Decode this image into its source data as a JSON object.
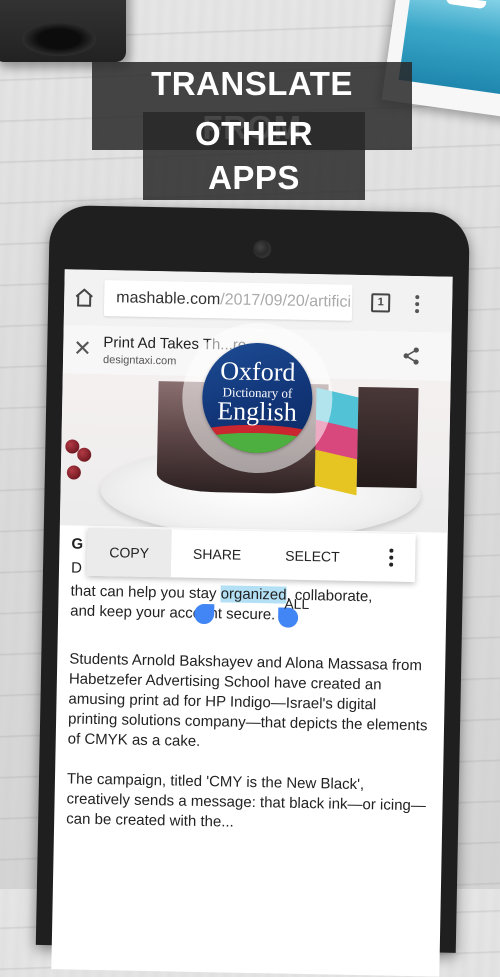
{
  "headline": {
    "line1": "TRANSLATE FROM",
    "line2": "OTHER APPS"
  },
  "browser": {
    "url_domain": "mashable.com",
    "url_path": "/2017/09/20/artifici",
    "tab_count": "1"
  },
  "custom_tab": {
    "title": "Print Ad Takes Th...re...",
    "domain": "designtaxi.com"
  },
  "app_badge": {
    "line1": "Oxford",
    "line2": "Dictionary of",
    "line3": "English",
    "colors": {
      "navy": "#113577",
      "red": "#c9262f",
      "green": "#4caf3f"
    }
  },
  "selection_toolbar": {
    "copy": "COPY",
    "share": "SHARE",
    "select_all": "SELECT ALL"
  },
  "article": {
    "partial_heading_char": "G",
    "partial_line_char": "D",
    "line3_before": "that can help you stay ",
    "selected_word": "organized",
    "line3_after": ", collaborate,",
    "line4": "and keep your account secure.",
    "paragraph2": "Students Arnold Bakshayev and Alona Massasa from Habetzefer Advertising School have created an amusing print ad for HP Indigo—Israel's digital printing solutions company—that depicts the elements of CMYK as a cake.",
    "paragraph3": "The campaign, titled 'CMY is the New Black', creatively sends a message: that black ink—or icing—can be created with the..."
  },
  "colors": {
    "selection_highlight": "#b3e0f5",
    "selection_handle": "#4285f4"
  }
}
